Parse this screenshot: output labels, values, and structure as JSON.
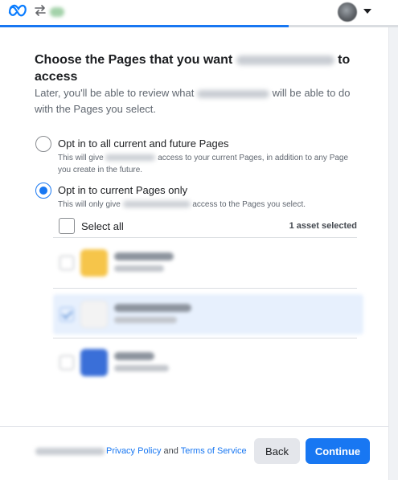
{
  "header": {
    "logo_icon": "meta-logo-icon",
    "switch_icon": "swap-arrows-icon",
    "account_menu_icon": "chevron-down-icon",
    "progress_percent": 72.5
  },
  "dialog": {
    "title_prefix": "Choose the Pages that you want",
    "title_suffix": "to access",
    "subtitle_prefix": "Later, you'll be able to review what",
    "subtitle_suffix": "will be able to do with the Pages you select.",
    "options": [
      {
        "label": "Opt in to all current and future Pages",
        "desc_prefix": "This will give",
        "desc_suffix": "access to your current Pages, in addition to any Page you create in the future.",
        "selected": false
      },
      {
        "label": "Opt in to current Pages only",
        "desc_prefix": "This will only give",
        "desc_suffix": "access to the Pages you select.",
        "selected": true
      }
    ],
    "select_all_label": "Select all",
    "asset_count": "1 asset selected"
  },
  "footer": {
    "privacy_link": "Privacy Policy",
    "and_text": " and ",
    "terms_link": "Terms of Service",
    "back_label": "Back",
    "continue_label": "Continue"
  },
  "colors": {
    "accent": "#1877f2",
    "selected_row": "#e7f0fd"
  }
}
